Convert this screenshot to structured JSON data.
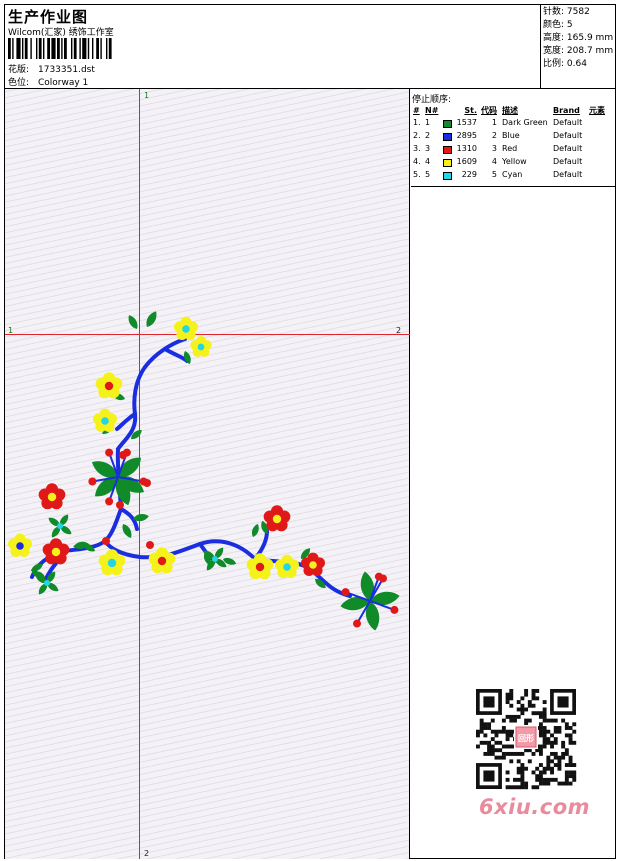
{
  "header": {
    "title": "生产作业图",
    "studio": "Wilcom(汇家) 绣饰工作室",
    "design": {
      "label": "花版:",
      "value": "1733351.dst"
    },
    "colorway": {
      "label": "色位:",
      "value": "Colorway 1"
    }
  },
  "stats": [
    {
      "label": "针数",
      "value": "7582"
    },
    {
      "label": "颜色",
      "value": "5"
    },
    {
      "label": "高度",
      "value": "165.9 mm"
    },
    {
      "label": "宽度",
      "value": "208.7 mm"
    },
    {
      "label": "比例",
      "value": "0.64"
    }
  ],
  "guides": {
    "h_left": "1",
    "h_right": "2",
    "v_top": "1",
    "v_bottom": "2"
  },
  "stop_sequence": {
    "title": "停止顺序:",
    "columns": {
      "index": "#",
      "needle": "N#",
      "stitches": "St.",
      "code": "代码",
      "desc": "描述",
      "brand": "Brand",
      "element": "元素"
    },
    "rows": [
      {
        "index": "1.",
        "needle": "1",
        "color": "#118a2a",
        "stitches": "1537",
        "code": "1",
        "desc": "Dark Green",
        "brand": "Default"
      },
      {
        "index": "2.",
        "needle": "2",
        "color": "#1a2ee0",
        "stitches": "2895",
        "code": "2",
        "desc": "Blue",
        "brand": "Default"
      },
      {
        "index": "3.",
        "needle": "3",
        "color": "#e01818",
        "stitches": "1310",
        "code": "3",
        "desc": "Red",
        "brand": "Default"
      },
      {
        "index": "4.",
        "needle": "4",
        "color": "#f4f21a",
        "stitches": "1609",
        "code": "4",
        "desc": "Yellow",
        "brand": "Default"
      },
      {
        "index": "5.",
        "needle": "5",
        "color": "#22d6e6",
        "stitches": "229",
        "code": "5",
        "desc": "Cyan",
        "brand": "Default"
      }
    ]
  },
  "watermark": {
    "text": "6xiu.com",
    "seal": "回形"
  }
}
